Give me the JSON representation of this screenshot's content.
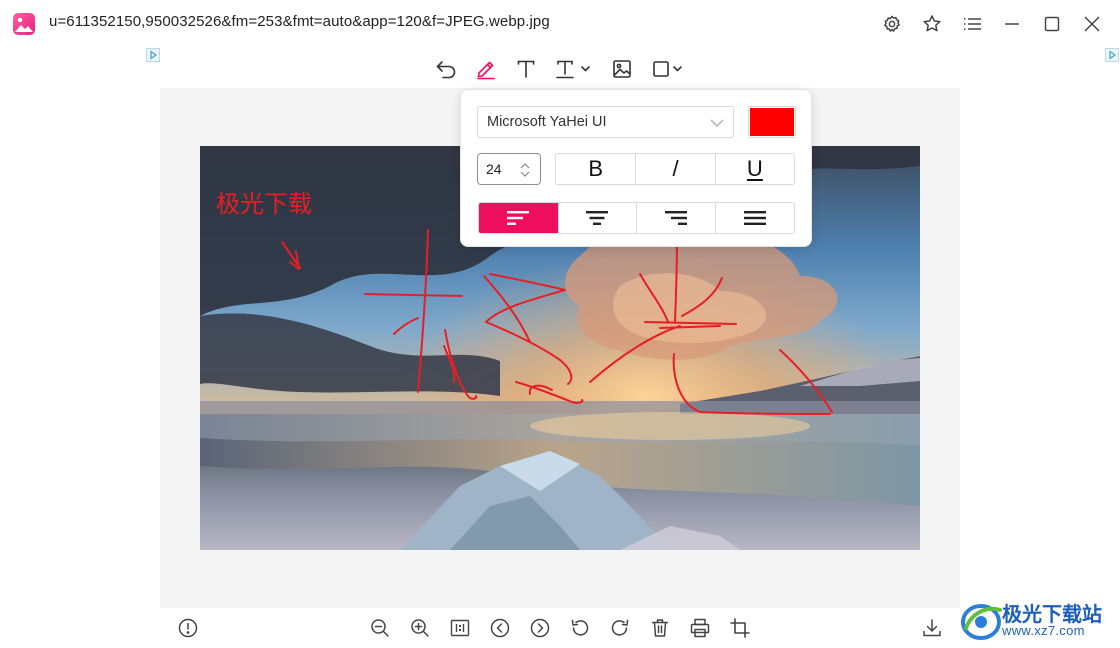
{
  "window": {
    "title": "u=611352150,950032526&fm=253&fmt=auto&app=120&f=JPEG.webp.jpg"
  },
  "titlebar_icons": [
    "gear-icon",
    "star-icon",
    "menu-list-icon",
    "minimize-icon",
    "maximize-icon",
    "close-icon"
  ],
  "toolbar": {
    "icons": [
      "undo-icon",
      "pen-icon",
      "text-icon",
      "text-style-icon",
      "image-icon",
      "shape-icon"
    ],
    "active": "pen-icon"
  },
  "canvas": {
    "annotation_text": "极光下载",
    "annotation_color": "#e81e25",
    "stroke_color": "#e81e25"
  },
  "text_popup": {
    "font_family_value": "Microsoft YaHei UI",
    "color": "#ff0000",
    "font_size": "24",
    "bold_label": "B",
    "italic_label": "/",
    "underline_label": "U",
    "alignments": [
      "align-left-icon",
      "align-center-icon",
      "align-right-icon",
      "align-justify-icon"
    ],
    "active_alignment": "align-left-icon",
    "accent_color": "#ee0e5c"
  },
  "bottom_bar": {
    "icons": [
      "info-icon",
      "zoom-out-icon",
      "zoom-in-icon",
      "actual-size-icon",
      "previous-icon",
      "next-icon",
      "rotate-left-icon",
      "rotate-right-icon",
      "delete-icon",
      "print-icon",
      "crop-icon",
      "download-icon"
    ]
  },
  "watermark": {
    "title": "极光下载站",
    "url": "www.xz7.com"
  }
}
